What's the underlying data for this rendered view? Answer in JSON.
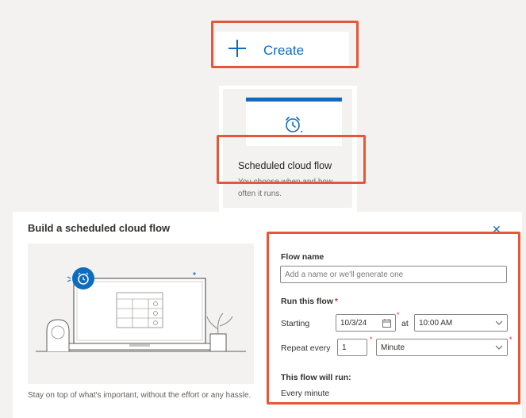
{
  "create_button": {
    "label": "Create"
  },
  "card": {
    "title": "Scheduled cloud flow",
    "description": "You choose when and how often it runs."
  },
  "dialog": {
    "title": "Build a scheduled cloud flow",
    "close_icon": "close-icon",
    "bottom_text": "Stay on top of what's important, without the effort or any hassle."
  },
  "form": {
    "flow_name_label": "Flow name",
    "flow_name_placeholder": "Add a name or we'll generate one",
    "run_label": "Run this flow",
    "required_marker": "*",
    "starting_label": "Starting",
    "start_date": "10/3/24",
    "at_label": "at",
    "start_time": "10:00 AM",
    "repeat_label": "Repeat every",
    "repeat_interval": "1",
    "repeat_unit": "Minute",
    "will_run_label": "This flow will run:",
    "will_run_value": "Every minute"
  },
  "colors": {
    "accent": "#0f6cbd",
    "highlight": "#e8563a",
    "required": "#c4314b"
  }
}
